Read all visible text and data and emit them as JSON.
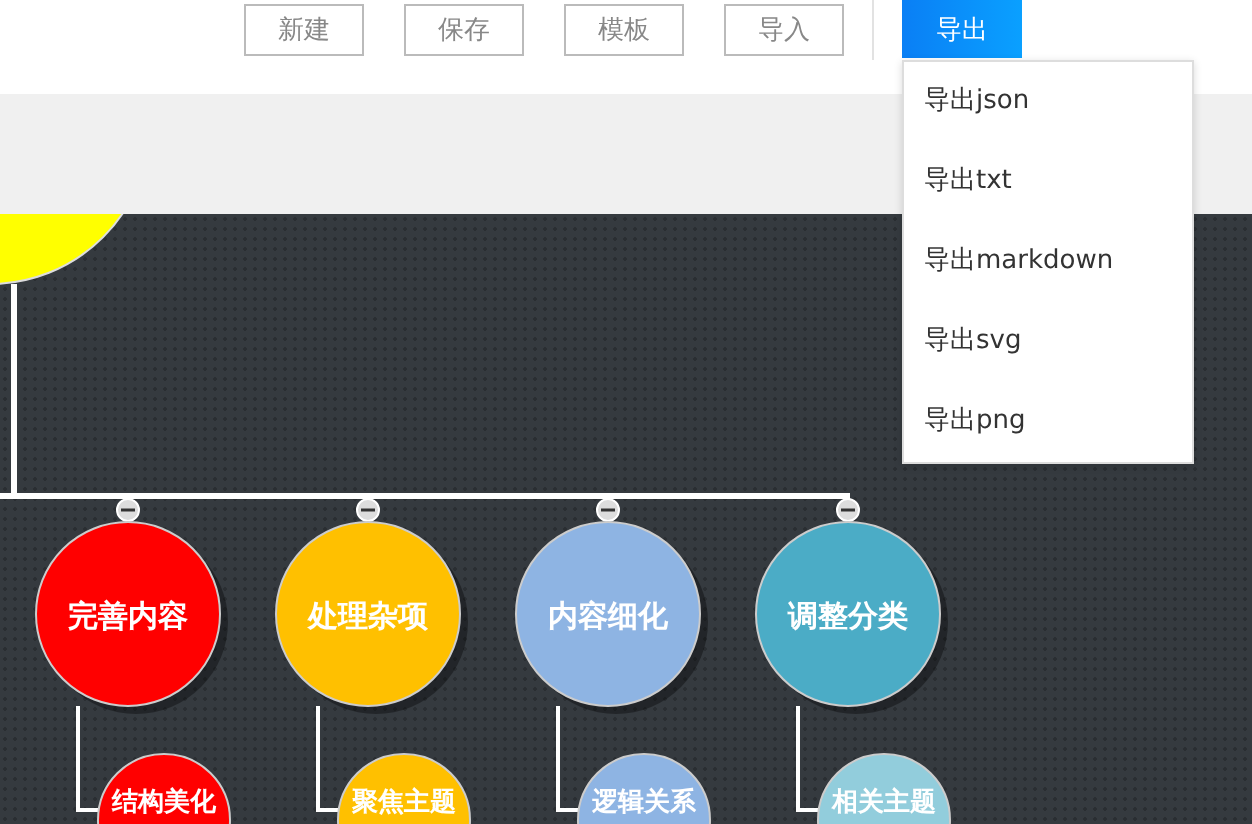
{
  "toolbar": {
    "buttons": [
      {
        "label": "新建",
        "kind": "plain"
      },
      {
        "label": "保存",
        "kind": "plain"
      },
      {
        "label": "模板",
        "kind": "plain"
      },
      {
        "label": "导入",
        "kind": "plain"
      },
      {
        "label": "导出",
        "kind": "primary"
      }
    ]
  },
  "export_menu": {
    "open": true,
    "items": [
      "导出json",
      "导出txt",
      "导出markdown",
      "导出svg",
      "导出png"
    ]
  },
  "mindmap": {
    "root": {
      "color": "#ffff00"
    },
    "branches": [
      {
        "label": "完善内容",
        "color": "#ff0000",
        "expanded": true,
        "children": [
          {
            "label": "结构美化",
            "color": "#ff0000"
          }
        ]
      },
      {
        "label": "处理杂项",
        "color": "#ffc000",
        "expanded": true,
        "children": [
          {
            "label": "聚焦主题",
            "color": "#ffc000"
          }
        ]
      },
      {
        "label": "内容细化",
        "color": "#8eb4e3",
        "expanded": true,
        "children": [
          {
            "label": "逻辑关系",
            "color": "#8eb4e3"
          }
        ]
      },
      {
        "label": "调整分类",
        "color": "#4bacc6",
        "expanded": true,
        "children": [
          {
            "label": "相关主题",
            "color": "#92cddc"
          }
        ]
      }
    ]
  }
}
